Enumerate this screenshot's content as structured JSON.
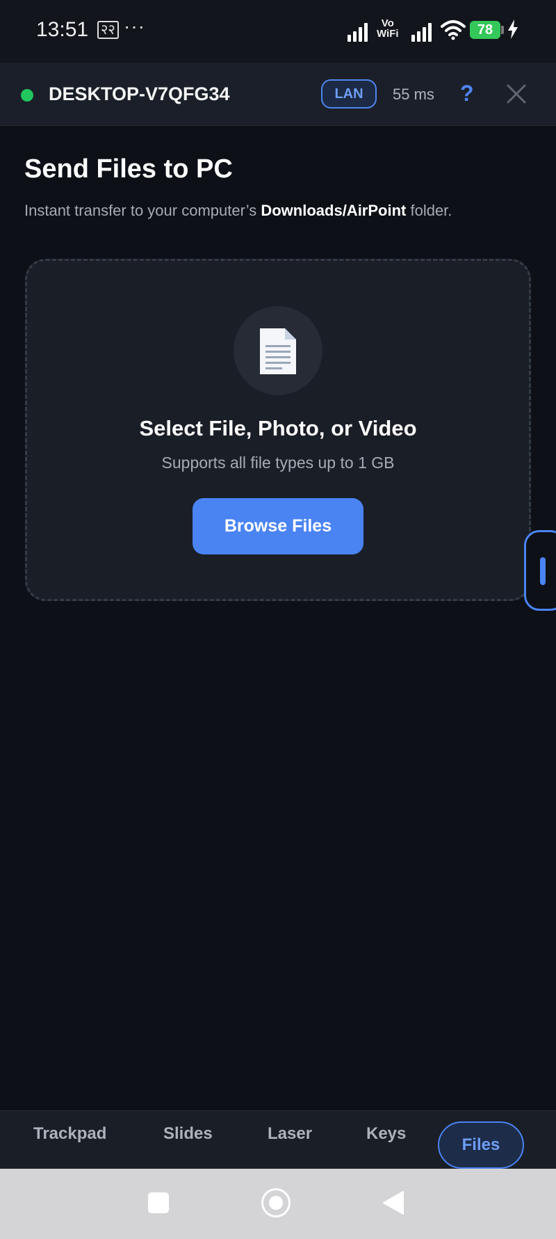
{
  "status_bar": {
    "time": "13:51",
    "sim_label": "२२",
    "more": "···",
    "vowifi_top": "Vo",
    "vowifi_bottom": "WiFi",
    "battery": "78",
    "icons": [
      "signal-icon",
      "vowifi-icon",
      "signal-icon",
      "wifi-icon",
      "battery-icon",
      "charging-icon"
    ]
  },
  "connection": {
    "status_color": "#22c55e",
    "device_name": "DESKTOP-V7QFG34",
    "network_badge": "LAN",
    "latency": "55 ms",
    "help_label": "?",
    "close_icon": "close-icon"
  },
  "page": {
    "title": "Send Files to PC",
    "subtitle_prefix": "Instant transfer to your computer’s ",
    "subtitle_bold": "Downloads/AirPoint",
    "subtitle_suffix": " folder."
  },
  "drop_zone": {
    "icon": "document-icon",
    "title": "Select File, Photo, or Video",
    "subtitle": "Supports all file types up to 1 GB",
    "button_label": "Browse Files"
  },
  "tabs": [
    {
      "label": "Trackpad",
      "active": false
    },
    {
      "label": "Slides",
      "active": false
    },
    {
      "label": "Laser",
      "active": false
    },
    {
      "label": "Keys",
      "active": false
    },
    {
      "label": "Files",
      "active": true
    }
  ],
  "colors": {
    "accent": "#4a84f3",
    "background": "#0d1017",
    "card": "#1a1e27",
    "online": "#22c55e"
  }
}
